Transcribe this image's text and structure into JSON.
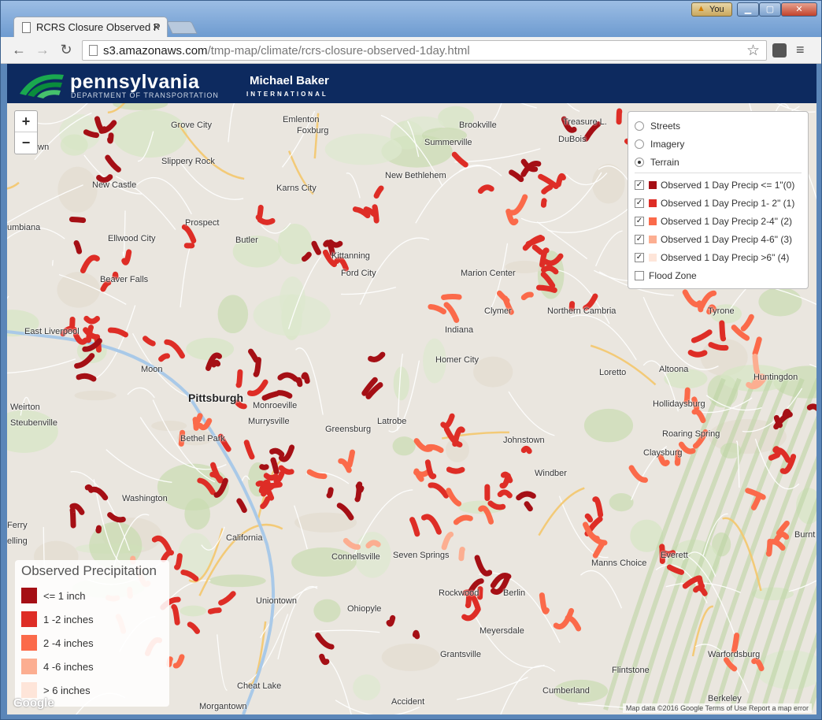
{
  "browser": {
    "tab_title": "RCRS Closure Observed P",
    "url_host": "s3.amazonaws.com",
    "url_path": "/tmp-map/climate/rcrs-closure-observed-1day.html",
    "user_label": "You"
  },
  "header": {
    "pa_title": "pennsylvania",
    "pa_sub": "DEPARTMENT OF TRANSPORTATION",
    "mb_title": "Michael Baker",
    "mb_sub": "INTERNATIONAL"
  },
  "zoom": {
    "in": "+",
    "out": "−"
  },
  "layers": {
    "base": [
      {
        "label": "Streets",
        "selected": false
      },
      {
        "label": "Imagery",
        "selected": false
      },
      {
        "label": "Terrain",
        "selected": true
      }
    ],
    "overlays": [
      {
        "label": "Observed 1 Day Precip <= 1\"(0)",
        "checked": true,
        "color": "#a50f15"
      },
      {
        "label": "Observed 1 Day Precip 1- 2\" (1)",
        "checked": true,
        "color": "#de2d26"
      },
      {
        "label": "Observed 1 Day Precip 2-4\" (2)",
        "checked": true,
        "color": "#fb6a4a"
      },
      {
        "label": "Observed 1 Day Precip 4-6\" (3)",
        "checked": true,
        "color": "#fcae91"
      },
      {
        "label": "Observed 1 Day Precip >6\" (4)",
        "checked": true,
        "color": "#fee5d9"
      },
      {
        "label": "Flood Zone",
        "checked": false,
        "color": ""
      }
    ]
  },
  "legend": {
    "title": "Observed Precipitation",
    "items": [
      {
        "label": "<= 1 inch",
        "color": "#a50f15"
      },
      {
        "label": "1 -2 inches",
        "color": "#de2d26"
      },
      {
        "label": "2 -4 inches",
        "color": "#fb6a4a"
      },
      {
        "label": "4 -6 inches",
        "color": "#fcae91"
      },
      {
        "label": "> 6 inches",
        "color": "#fee5d9"
      }
    ]
  },
  "towns": [
    "Grove City",
    "Emlenton",
    "Foxburg",
    "Brookville",
    "Summerville",
    "Treasure L.",
    "DuBois",
    "New Castle",
    "Slippery Rock",
    "Karns City",
    "New Bethlehem",
    "Prospect",
    "Butler",
    "Kittanning",
    "Ford City",
    "Ellwood City",
    "Beaver Falls",
    "Marion Center",
    "Clymer",
    "Northern Cambria",
    "East Liverpool",
    "Indiana",
    "Homer City",
    "Loretto",
    "Altoona",
    "Tyrone",
    "Huntingdon",
    "Moon",
    "Pittsburgh",
    "Monroeville",
    "Murrysville",
    "Latrobe",
    "Weirton",
    "Steubenville",
    "Bethel Park",
    "Greensburg",
    "Johnstown",
    "Hollidaysburg",
    "Roaring Spring",
    "Claysburg",
    "Windber",
    "Washington",
    "Ferry",
    "elling",
    "California",
    "Connellsville",
    "Seven Springs",
    "Berlin",
    "Manns Choice",
    "Everett",
    "Uniontown",
    "Ohiopyle",
    "Rockwood",
    "Meyersdale",
    "Warfordsburg",
    "Grantsville",
    "Cheat Lake",
    "Accident",
    "Morgantown",
    "Flintstone",
    "Cumberland",
    "Berkeley",
    "Burnt",
    "town",
    "umbiana"
  ],
  "attribution": "Map data ©2016 Google   Terms of Use   Report a map error",
  "google_logo": "Google"
}
